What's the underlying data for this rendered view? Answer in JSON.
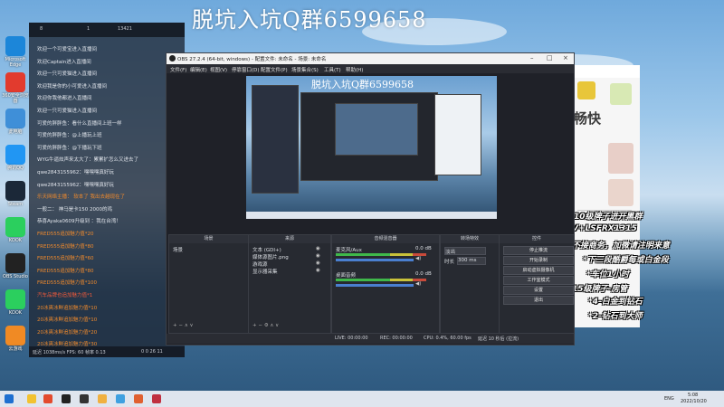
{
  "overlay_title": "脱坑入坑Q群6599658",
  "desktop_icons": [
    {
      "label": "Microsoft Edge",
      "color": "#1c86d9"
    },
    {
      "label": "360安全浏览器",
      "color": "#e23b2e"
    },
    {
      "label": "此电脑",
      "color": "#3f8fd8"
    },
    {
      "label": "腾讯QQ",
      "color": "#2196f3"
    },
    {
      "label": "Steam",
      "color": "#1b2838"
    },
    {
      "label": "KOOK",
      "color": "#2bcf5e"
    },
    {
      "label": "OBS Studio",
      "color": "#222222"
    },
    {
      "label": "KOOK",
      "color": "#2bcf5e"
    },
    {
      "label": "云游戏",
      "color": "#f08a24"
    }
  ],
  "chat": {
    "header": [
      "8",
      "1",
      "13421"
    ],
    "messages": [
      {
        "text": "欢迎一个可爱宝进入直播间",
        "style": "normal"
      },
      {
        "text": "欢迎Captain进入直播间",
        "style": "normal"
      },
      {
        "text": "欢迎一只可爱猫进入直播间",
        "style": "normal"
      },
      {
        "text": "欢迎我是你的小可爱进入直播间",
        "style": "normal"
      },
      {
        "text": "欢迎你我他都进入直播间",
        "style": "normal"
      },
      {
        "text": "欢迎一只可爱猫进入直播间",
        "style": "normal"
      },
      {
        "text": "可爱的胖胖鱼：看什么直播间上班一样",
        "style": "normal"
      },
      {
        "text": "可爱的胖胖鱼：@上播玩上班",
        "style": "normal"
      },
      {
        "text": "可爱的胖胖鱼：@下播玩下班",
        "style": "normal"
      },
      {
        "text": "WYG牛逼炫声来太大了：累累扩怎么又进去了",
        "style": "normal"
      },
      {
        "text": "qwe2843155962：嘿嘿嘿真好玩",
        "style": "normal"
      },
      {
        "text": "qwe2843155962：嘿嘿嘿真好玩",
        "style": "normal"
      },
      {
        "text": "乐天网络主播：  软本了 我出去越现在了",
        "style": "orange"
      },
      {
        "text": "一般二：  神马是卡150 2000的鸡",
        "style": "normal"
      },
      {
        "text": "恭喜Ayaka0609升级到  ：我在台湾！",
        "style": "normal"
      },
      {
        "text": "FRED555追加魅力值*20",
        "style": "orange"
      },
      {
        "text": "FRED555追加魅力值*80",
        "style": "orange"
      },
      {
        "text": "FRED555追加魅力值*60",
        "style": "orange"
      },
      {
        "text": "FRED555追加魅力值*80",
        "style": "orange"
      },
      {
        "text": "FRED555追加魅力值*100",
        "style": "orange"
      },
      {
        "text": "汽车品牌也追加魅力值*1",
        "style": "red"
      },
      {
        "text": "20冰爽冰鲜追加魅力值*10",
        "style": "orange"
      },
      {
        "text": "20冰爽冰鲜追加魅力值*10",
        "style": "orange"
      },
      {
        "text": "20冰爽冰鲜追加魅力值*20",
        "style": "orange"
      },
      {
        "text": "20冰爽冰鲜追加魅力值*30",
        "style": "orange"
      }
    ],
    "footer_left": "延迟  1038ms/s  FPS: 60  帧率 0.13",
    "footer_right": "0  0  26  11"
  },
  "obs": {
    "title": "OBS 27.2.4 (64-bit, windows) - 配置文件: 未命名 - 场景: 未命名",
    "menu": [
      "文件(F)",
      "编辑(E)",
      "视图(V)",
      "停靠窗口(D)",
      "配置文件(P)",
      "场景集合(S)",
      "工具(T)",
      "帮助(H)"
    ],
    "preview_title": "脱坑入坑Q群6599658",
    "panels": {
      "scenes": "场景",
      "scenes_item": "场景",
      "sources": "来源",
      "source_items": [
        "文本 (GDI+)",
        "媒体源图片.png",
        "游戏源",
        "显示器采集"
      ],
      "mixer": "音频混音器",
      "mixer_tracks": [
        {
          "name": "麦克风/Aux",
          "db": "0.0 dB"
        },
        {
          "name": "桌面音频",
          "db": "0.0 dB"
        }
      ],
      "transitions": "转场特效",
      "transition_type": "淡出",
      "duration_label": "时长",
      "duration_value": "300 ms",
      "controls": "控件",
      "buttons": [
        "停止推流",
        "开始录制",
        "启动虚拟摄像机",
        "工作室模式",
        "设置",
        "退出"
      ]
    },
    "status": [
      "LIVE: 00:00:00",
      "REC: 00:00:00",
      "CPU: 0.4%, 60.00 fps",
      "延迟 10 秒后 (拉流)"
    ]
  },
  "right_overlay": {
    "header_text": "畅快",
    "lines": [
      "10级牌子进开黑群",
      "V+LSFRX1315",
      "不接商务，加微请注明来意",
      "*下三段酷爵每或白金段",
      "*车位1小时",
      "15级牌子-房管",
      "*4-白金到钻石",
      "*2-钻石到大师"
    ]
  },
  "taskbar": {
    "lang": "ENG",
    "time": "5:08",
    "date": "2022/10/20"
  },
  "colors": {
    "obs_bg": "#1f2128",
    "chat_orange": "#f08a2c",
    "meter_green": "#3fb84a"
  }
}
